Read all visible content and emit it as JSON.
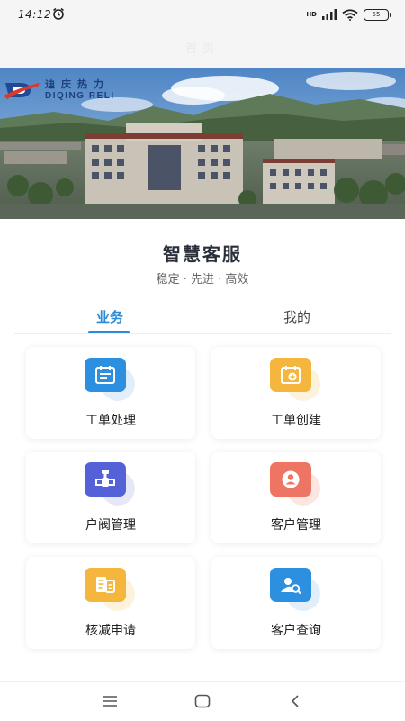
{
  "status_bar": {
    "time": "14:12",
    "network": "HD",
    "battery": "55"
  },
  "header": {
    "title": "首页"
  },
  "banner": {
    "logo_cn": "迪庆热力",
    "logo_en": "DIQING RELI"
  },
  "hero": {
    "title": "智慧客服",
    "subtitle": "稳定 · 先进 · 高效"
  },
  "tabs": [
    {
      "label": "业务",
      "active": true
    },
    {
      "label": "我的",
      "active": false
    }
  ],
  "cards": [
    {
      "label": "工单处理",
      "icon": "work-order-process-icon",
      "color": "#2d8fe0"
    },
    {
      "label": "工单创建",
      "icon": "work-order-create-icon",
      "color": "#f4b63d"
    },
    {
      "label": "户阀管理",
      "icon": "valve-manage-icon",
      "color": "#5561d6"
    },
    {
      "label": "客户管理",
      "icon": "customer-manage-icon",
      "color": "#ee7464"
    },
    {
      "label": "核减申请",
      "icon": "reduction-apply-icon",
      "color": "#f4b63d"
    },
    {
      "label": "客户查询",
      "icon": "customer-search-icon",
      "color": "#2d8fe0"
    }
  ],
  "accent_color": "#2e8ad6"
}
